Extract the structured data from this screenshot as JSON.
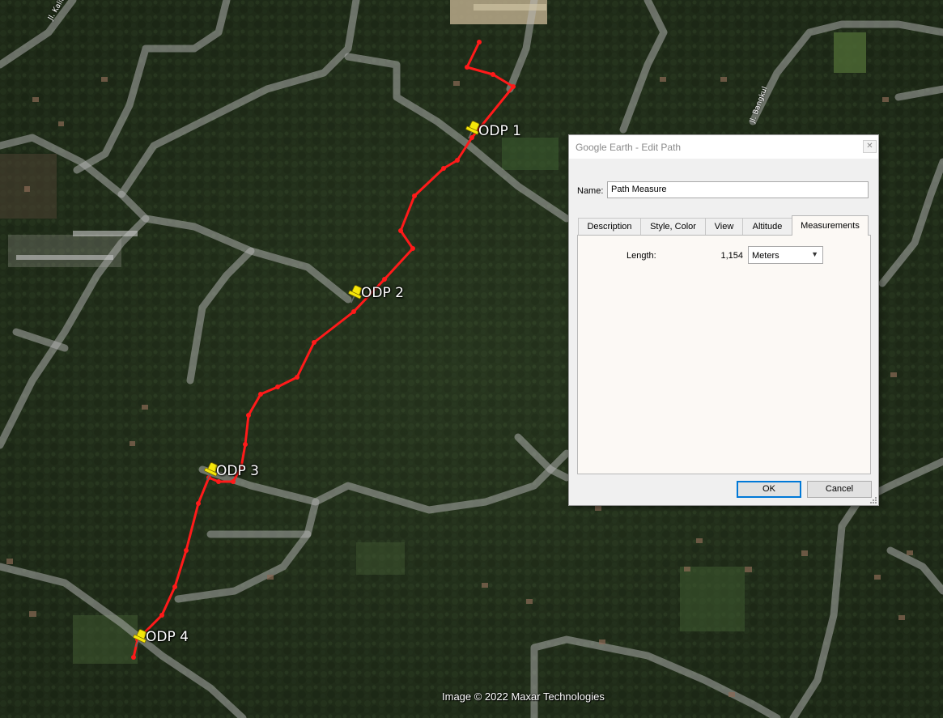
{
  "map": {
    "attribution": "Image © 2022 Maxar Technologies",
    "road_labels": [
      "Jl. Kaliurang",
      "Jl. Bangkul"
    ],
    "placemarks": [
      {
        "id": "odp1",
        "label": "ODP 1"
      },
      {
        "id": "odp2",
        "label": "ODP 2"
      },
      {
        "id": "odp3",
        "label": "ODP 3"
      },
      {
        "id": "odp4",
        "label": "ODP 4"
      }
    ],
    "path_color": "#ff1a1a",
    "pin_color": "#f5e60a"
  },
  "dialog": {
    "title": "Google Earth - Edit Path",
    "close_icon": "close-icon",
    "name_label": "Name:",
    "name_value": "Path Measure",
    "tabs": [
      {
        "label": "Description"
      },
      {
        "label": "Style, Color"
      },
      {
        "label": "View"
      },
      {
        "label": "Altitude"
      },
      {
        "label": "Measurements",
        "active": true
      }
    ],
    "measurements": {
      "length_label": "Length:",
      "length_value": "1,154",
      "unit_selected": "Meters"
    },
    "ok_label": "OK",
    "cancel_label": "Cancel"
  }
}
